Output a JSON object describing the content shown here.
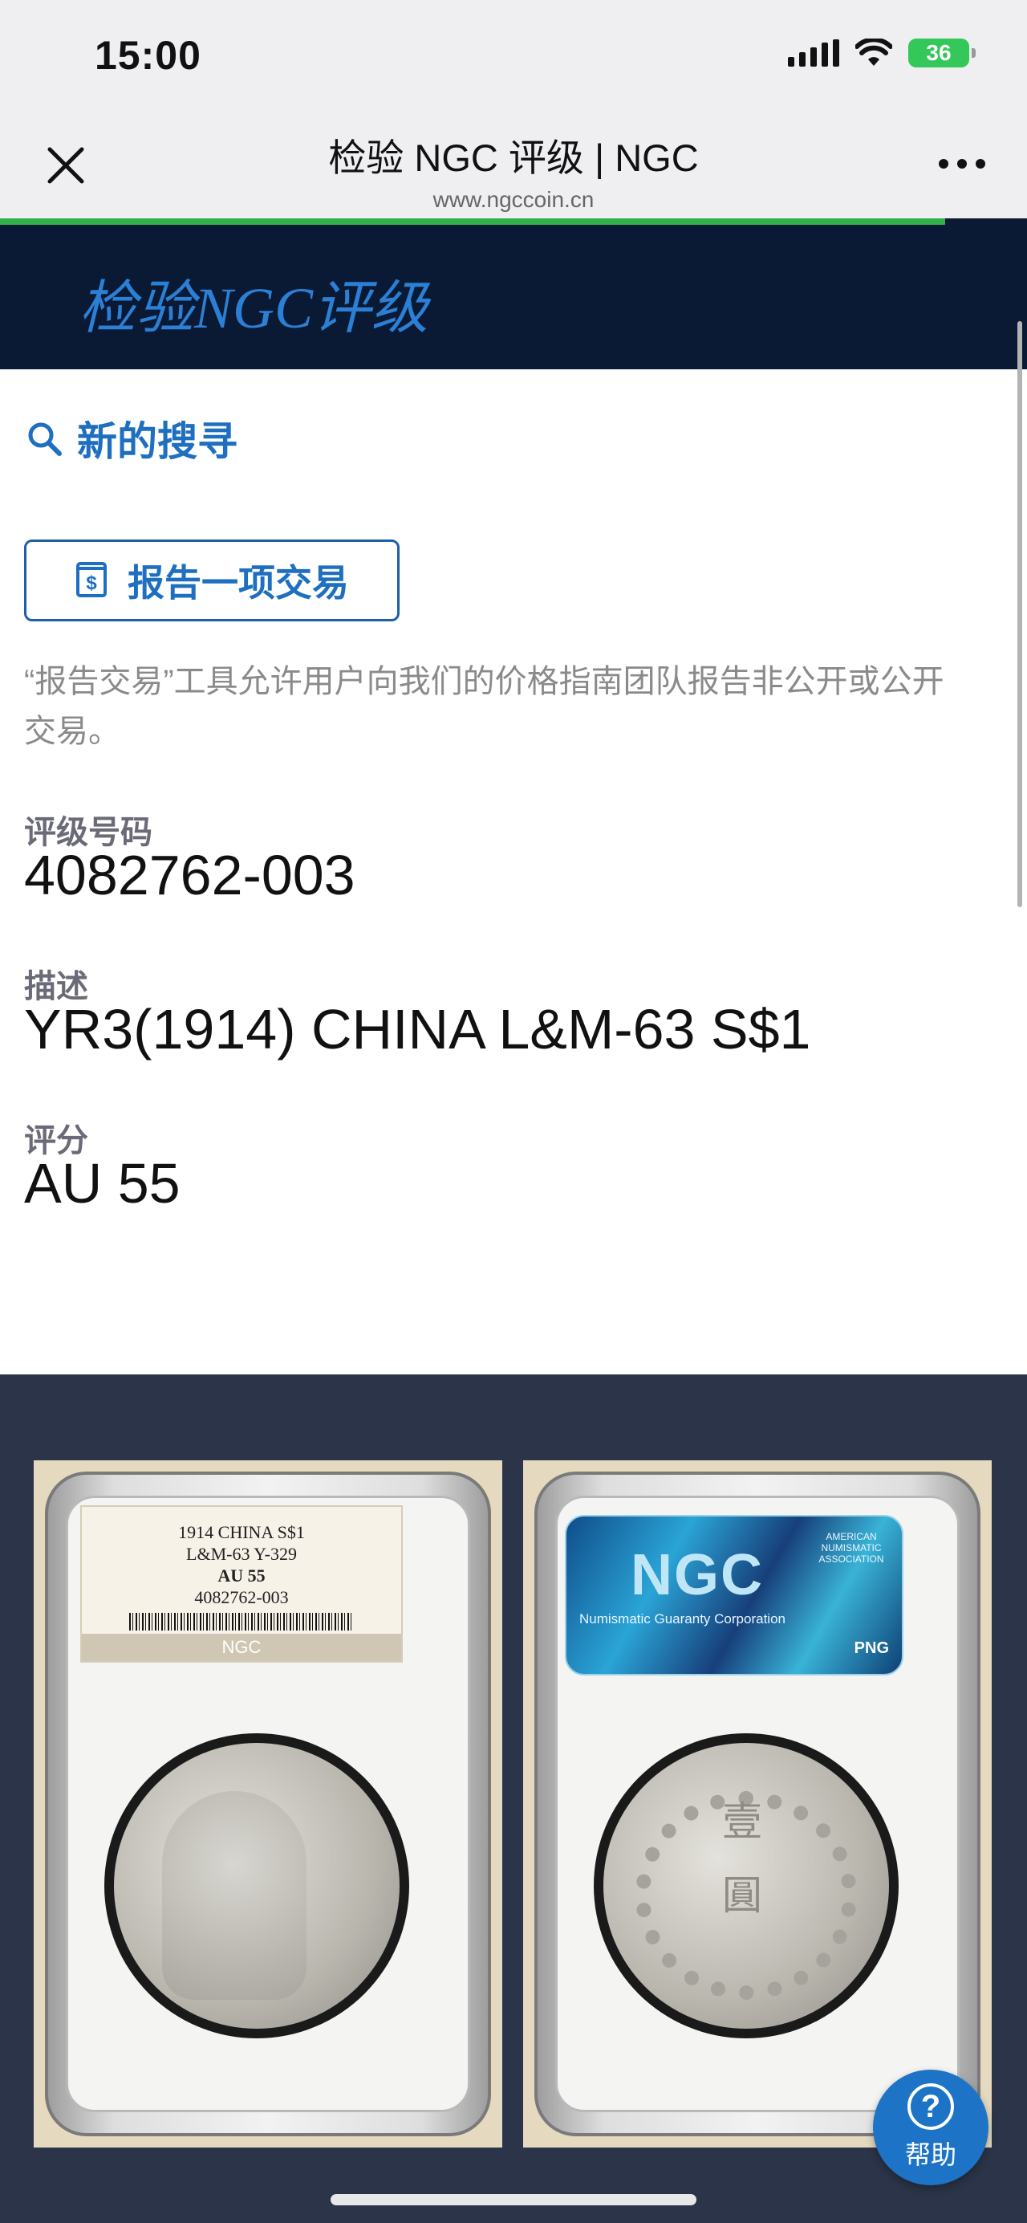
{
  "status_bar": {
    "time": "15:00",
    "battery": "36"
  },
  "browser": {
    "title": "检验 NGC 评级 | NGC",
    "url": "www.ngccoin.cn",
    "load_progress": 0.92
  },
  "site": {
    "heading": "检验NGC评级"
  },
  "actions": {
    "new_search_label": "新的搜寻",
    "report_button_label": "报告一项交易"
  },
  "description": "“报告交易”工具允许用户向我们的价格指南团队报告非公开或公开交易。",
  "fields": {
    "cert_label": "评级号码",
    "cert_value": "4082762-003",
    "desc_label": "描述",
    "desc_value": "YR3(1914) CHINA L&M-63 S$1",
    "grade_label": "评分",
    "grade_value": "AU 55"
  },
  "slab_label": {
    "line1": "1914 CHINA S$1",
    "line2": "L&M-63 Y-329",
    "line3": "AU 55",
    "line4": "4082762-003",
    "brand": "NGC"
  },
  "holo_label": {
    "logo": "NGC",
    "subtitle": "Numismatic Guaranty Corporation",
    "ana": "AMERICAN NUMISMATIC ASSOCIATION",
    "png": "PNG"
  },
  "help": {
    "label": "帮助",
    "symbol": "?"
  },
  "colors": {
    "accent": "#1f6fc0",
    "header_bg": "#0a1a35",
    "progress": "#2fb24a",
    "gallery_bg": "#2b3448"
  }
}
